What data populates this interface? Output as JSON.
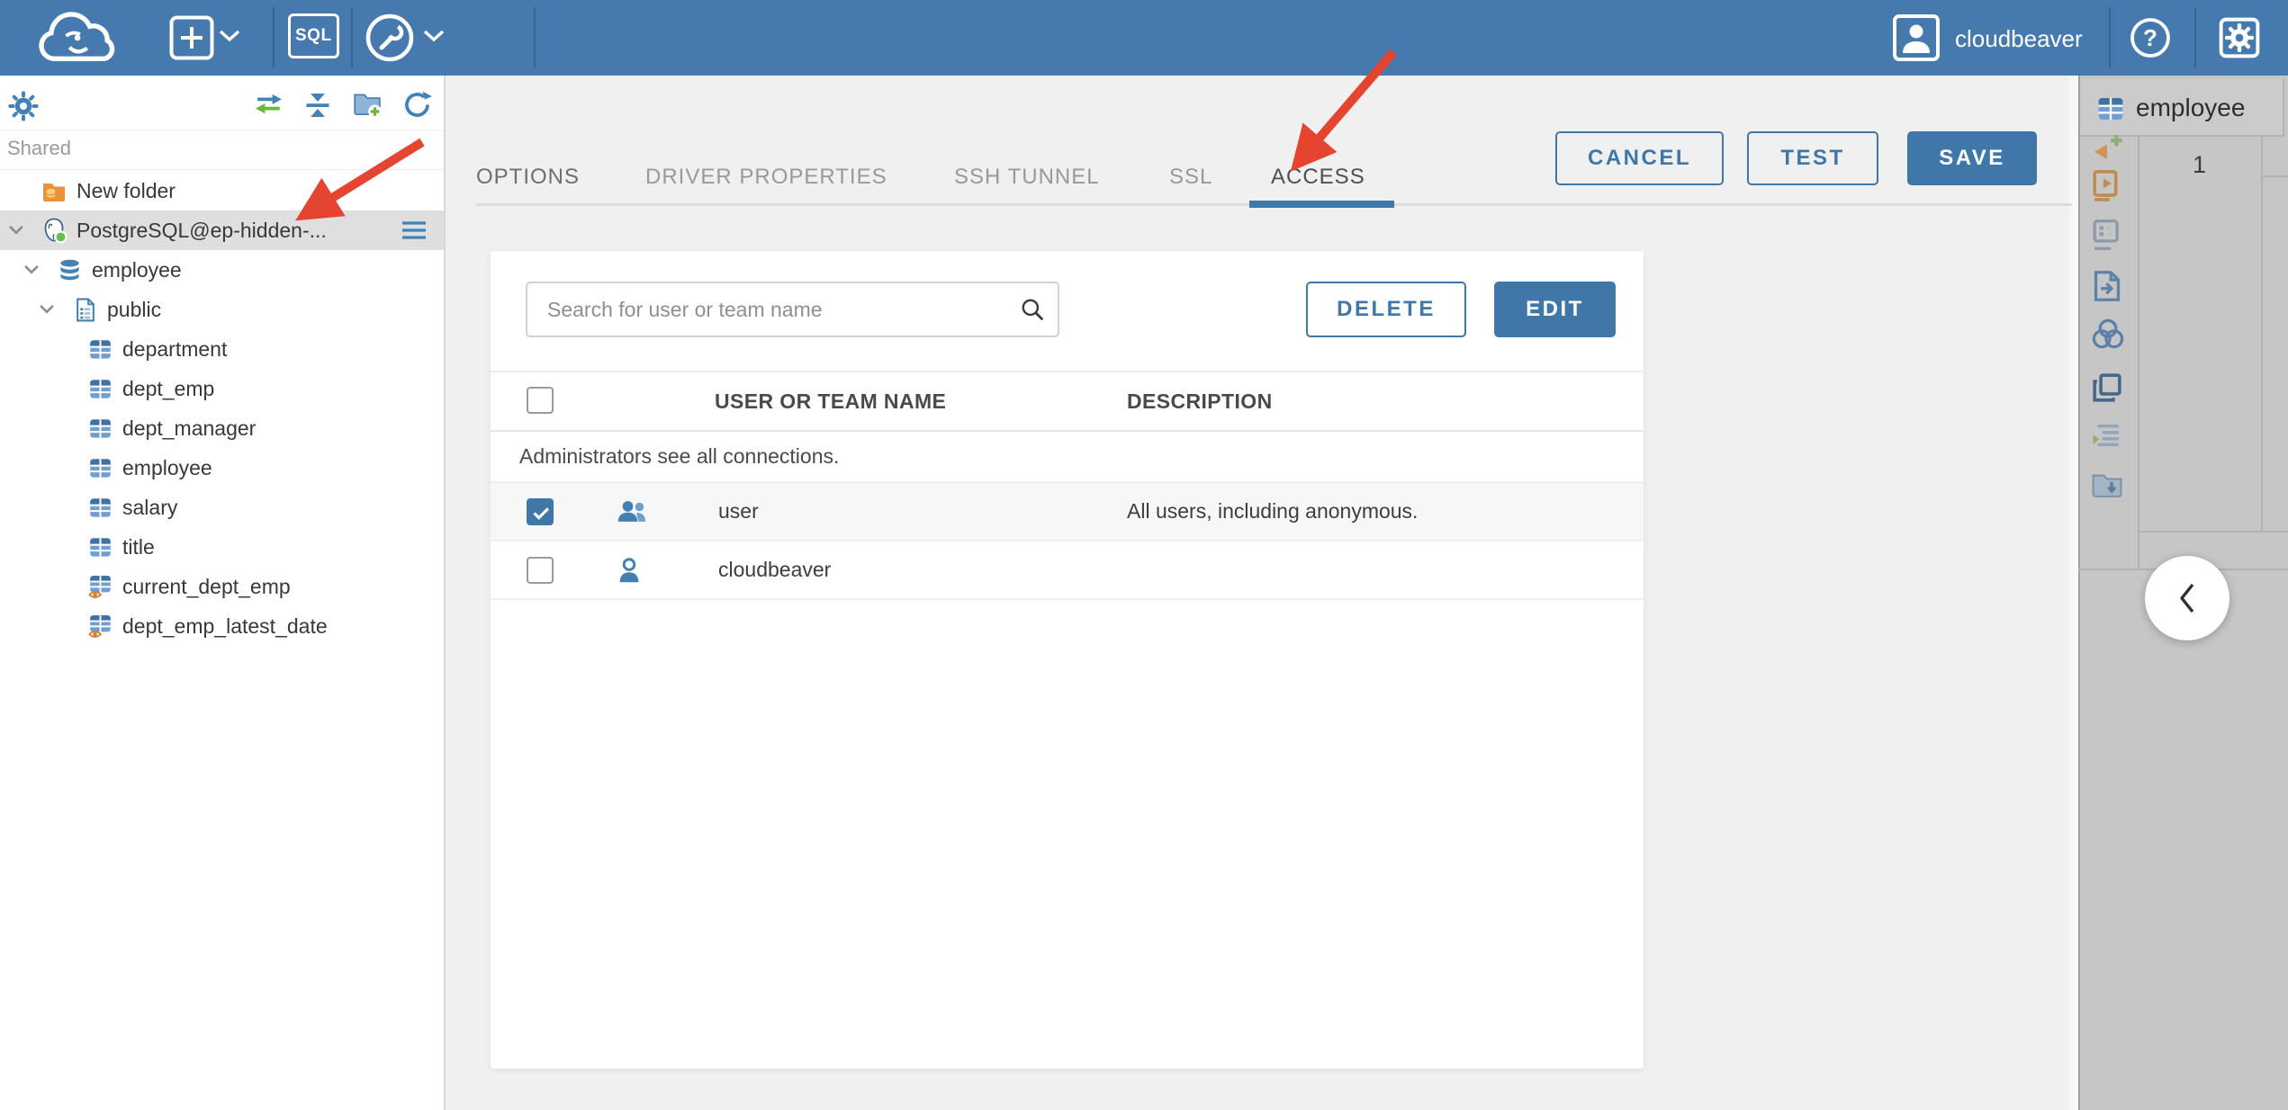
{
  "header": {
    "sql_button_label": "SQL",
    "username": "cloudbeaver",
    "help_glyph": "?"
  },
  "sidebar": {
    "section_label": "Shared",
    "items": [
      {
        "label": "New folder",
        "icon": "folder-database-icon",
        "level": 1,
        "expandable": false,
        "selected": false
      },
      {
        "label": "PostgreSQL@ep-hidden-...",
        "icon": "postgresql-icon",
        "level": 1,
        "expandable": true,
        "selected": true,
        "has_menu": true
      },
      {
        "label": "employee",
        "icon": "database-icon",
        "level": 2,
        "expandable": true
      },
      {
        "label": "public",
        "icon": "schema-icon",
        "level": 3,
        "expandable": true
      },
      {
        "label": "department",
        "icon": "table-icon",
        "level": 4
      },
      {
        "label": "dept_emp",
        "icon": "table-icon",
        "level": 4
      },
      {
        "label": "dept_manager",
        "icon": "table-icon",
        "level": 4
      },
      {
        "label": "employee",
        "icon": "table-icon",
        "level": 4
      },
      {
        "label": "salary",
        "icon": "table-icon",
        "level": 4
      },
      {
        "label": "title",
        "icon": "table-icon",
        "level": 4
      },
      {
        "label": "current_dept_emp",
        "icon": "view-icon",
        "level": 4
      },
      {
        "label": "dept_emp_latest_date",
        "icon": "view-icon",
        "level": 4
      }
    ]
  },
  "connection_dialog": {
    "tabs": [
      {
        "label": "OPTIONS",
        "active": false
      },
      {
        "label": "DRIVER PROPERTIES",
        "active": false
      },
      {
        "label": "SSH TUNNEL",
        "active": false
      },
      {
        "label": "SSL",
        "active": false
      },
      {
        "label": "ACCESS",
        "active": true
      }
    ],
    "actions": {
      "cancel": "CANCEL",
      "test": "TEST",
      "save": "SAVE"
    },
    "access": {
      "search_placeholder": "Search for user or team name",
      "delete_label": "DELETE",
      "edit_label": "EDIT",
      "columns": [
        "USER OR TEAM NAME",
        "DESCRIPTION"
      ],
      "info_row": "Administrators see all connections.",
      "rows": [
        {
          "name": "user",
          "description": "All users, including anonymous.",
          "checked": true,
          "icon": "team-icon",
          "highlighted": true
        },
        {
          "name": "cloudbeaver",
          "description": "",
          "checked": false,
          "icon": "user-icon",
          "highlighted": false
        }
      ]
    }
  },
  "right_panel": {
    "tab_label": "employee",
    "row_number": "1",
    "toolbar_icons": [
      "add-item-icon",
      "script-play-icon",
      "grid-view-icon",
      "export-data-icon",
      "mock-data-icon",
      "duplicate-icon",
      "logs-icon",
      "save-folder-icon"
    ]
  },
  "colors": {
    "accent": "#4077a9",
    "header_blue": "#4679ad",
    "annotation_arrow": "#e54430",
    "selected_row": "#dfdfdf"
  }
}
